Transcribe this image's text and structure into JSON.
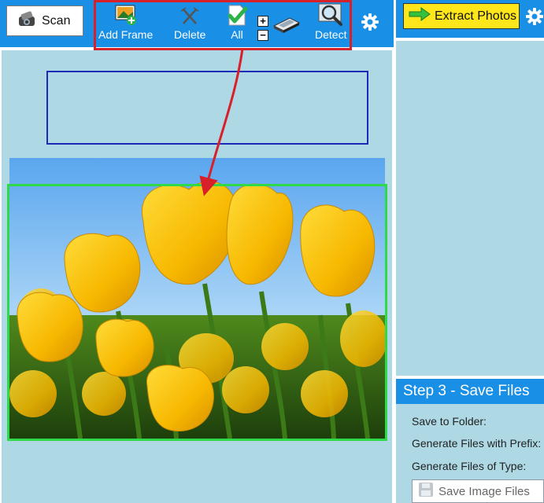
{
  "toolbar": {
    "scan_label": "Scan",
    "add_frame_label": "Add Frame",
    "delete_label": "Delete",
    "all_label": "All",
    "plus_label": "+",
    "minus_label": "−",
    "detect_label": "Detect"
  },
  "right_toolbar": {
    "extract_label": "Extract Photos"
  },
  "step3": {
    "title": "Step 3 - Save Files",
    "save_to_folder_label": "Save to Folder:",
    "prefix_label": "Generate Files with Prefix:",
    "type_label": "Generate Files of Type:",
    "save_button_label": "Save Image Files"
  },
  "colors": {
    "toolbar_blue": "#1a8fe6",
    "canvas_light_blue": "#add8e4",
    "extract_yellow": "#ffe61a",
    "annotation_red": "#d8202b",
    "selection_blue": "#1d2ab8",
    "selection_green": "#2fd94a"
  },
  "icons": [
    "scanner-icon",
    "add-frame-icon",
    "delete-icon",
    "select-all-icon",
    "plus-icon",
    "minus-icon",
    "flatbed-scanner-icon",
    "detect-icon",
    "gear-icon",
    "arrow-right-icon",
    "floppy-disk-icon"
  ],
  "image": "tulips-photo"
}
